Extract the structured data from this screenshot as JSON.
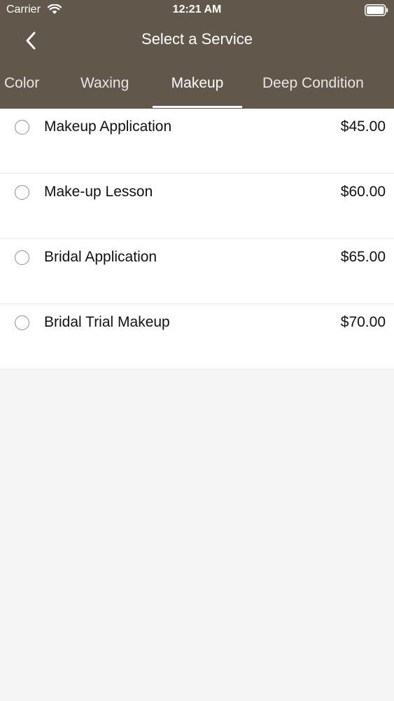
{
  "status_bar": {
    "carrier": "Carrier",
    "time": "12:21 AM",
    "icons": [
      "wifi-icon",
      "battery-icon"
    ]
  },
  "nav": {
    "title": "Select a Service",
    "back_icon": "chevron-left-icon"
  },
  "tabs": [
    {
      "label": "Color",
      "active": false
    },
    {
      "label": "Waxing",
      "active": false
    },
    {
      "label": "Makeup",
      "active": true
    },
    {
      "label": "Deep Condition",
      "active": false
    }
  ],
  "services": [
    {
      "name": "Makeup Application",
      "price": "$45.00",
      "selected": false
    },
    {
      "name": "Make-up Lesson",
      "price": "$60.00",
      "selected": false
    },
    {
      "name": "Bridal Application",
      "price": "$65.00",
      "selected": false
    },
    {
      "name": "Bridal Trial Makeup",
      "price": "$70.00",
      "selected": false
    }
  ],
  "colors": {
    "header_bg": "#62574b",
    "list_bg": "#ffffff",
    "page_bg": "#f6f5f5"
  }
}
